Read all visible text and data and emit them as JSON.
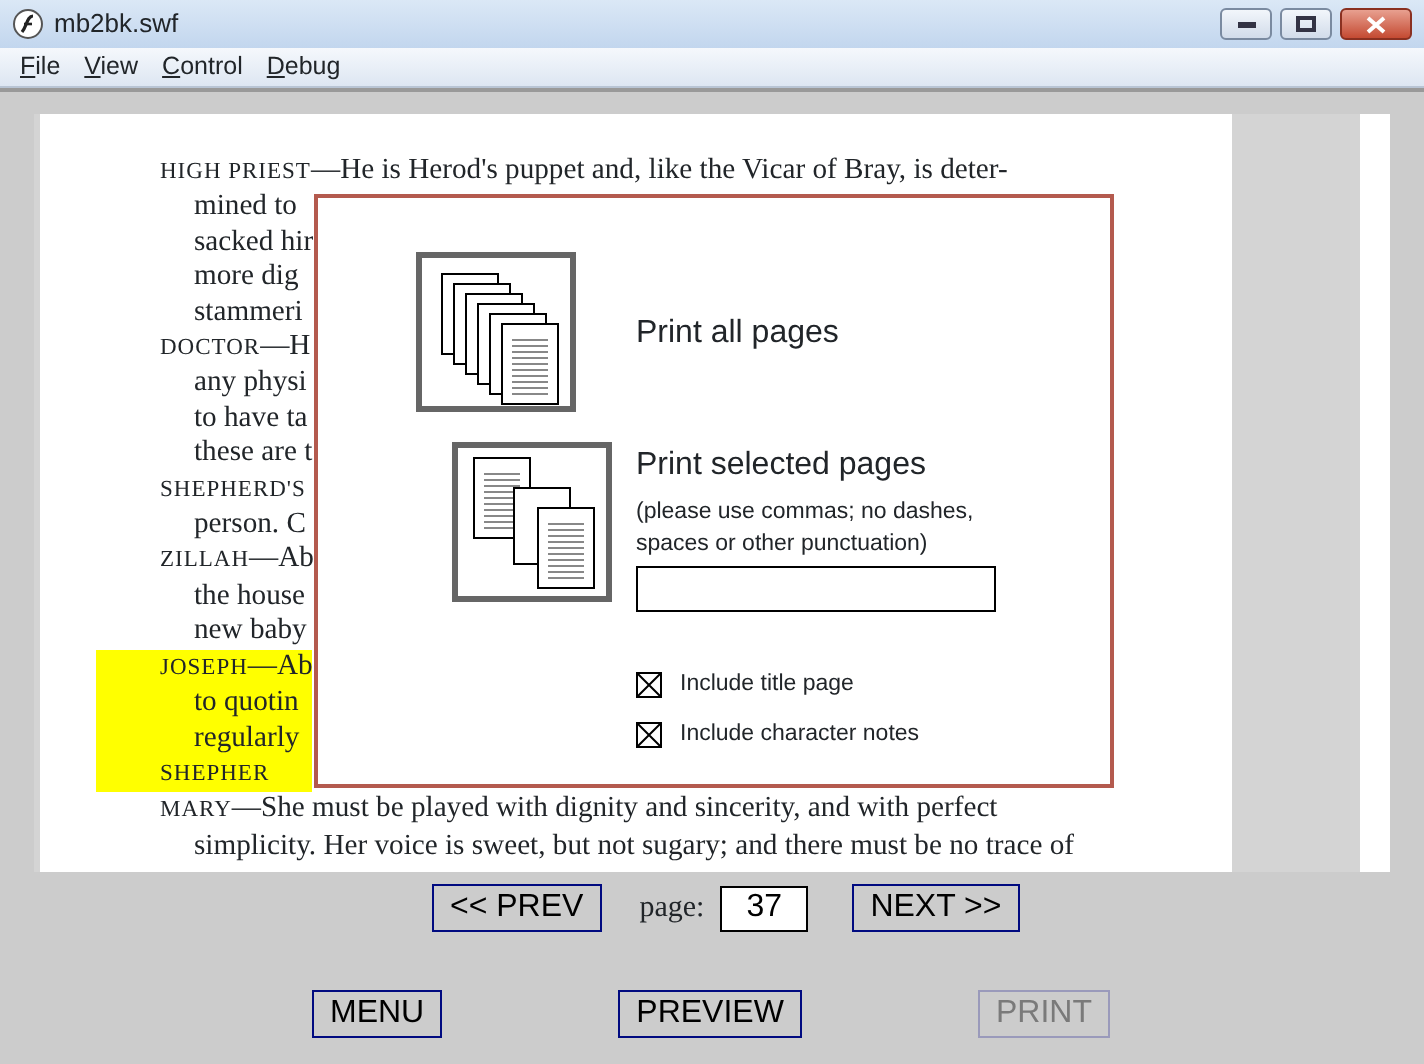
{
  "window": {
    "title": "mb2bk.swf"
  },
  "menu": [
    {
      "label": "File"
    },
    {
      "label": "View"
    },
    {
      "label": "Control"
    },
    {
      "label": "Debug"
    }
  ],
  "document": {
    "lines": [
      {
        "kind": "speech",
        "speaker": "HIGH PRIEST",
        "text": "—He is Herod's puppet and, like the Vicar of Bray, is deter-",
        "highlighted": false
      },
      {
        "kind": "continuation",
        "text": "mined to",
        "highlighted": false
      },
      {
        "kind": "continuation",
        "text": "sacked hir",
        "highlighted": false
      },
      {
        "kind": "continuation",
        "text": "more dig",
        "highlighted": false
      },
      {
        "kind": "continuation",
        "text": "stammeri",
        "highlighted": false
      },
      {
        "kind": "speech",
        "speaker": "DOCTOR",
        "text": "—H",
        "highlighted": false
      },
      {
        "kind": "continuation",
        "text": "any physi",
        "highlighted": false
      },
      {
        "kind": "continuation",
        "text": "to have ta",
        "highlighted": false
      },
      {
        "kind": "continuation",
        "text": "these are t",
        "highlighted": false
      },
      {
        "kind": "speech",
        "speaker": "SHEPHERD'S",
        "highlighted": false
      },
      {
        "kind": "continuation",
        "text": "person. C",
        "highlighted": false
      },
      {
        "kind": "speech",
        "speaker": "ZILLAH",
        "text": "—Ab",
        "highlighted": false
      },
      {
        "kind": "continuation",
        "text": "the house",
        "highlighted": false
      },
      {
        "kind": "continuation",
        "text": "new baby",
        "highlighted": false
      },
      {
        "kind": "speech",
        "speaker": "JOSEPH",
        "text": "—Ab",
        "highlighted": true
      },
      {
        "kind": "continuation",
        "text": "to quotin",
        "highlighted": true
      },
      {
        "kind": "continuation",
        "text": "regularly",
        "highlighted": true
      },
      {
        "kind": "speech",
        "speaker": "SHEPHER",
        "highlighted": true
      },
      {
        "kind": "speech",
        "speaker": "MARY",
        "text": "—She must be played with dignity and sincerity, and with perfect",
        "highlighted": false
      },
      {
        "kind": "continuation",
        "text": "simplicity. Her voice is sweet, but not sugary; and there must be no trace of",
        "highlighted": false
      }
    ]
  },
  "print_dialog": {
    "options": [
      {
        "kind": "all",
        "label": "Print all pages"
      },
      {
        "kind": "selected",
        "label": "Print selected pages",
        "note": "(please use commas; no dashes, spaces or other punctuation)"
      }
    ],
    "checkboxes": [
      {
        "label": "Include title page",
        "checked": true
      },
      {
        "label": "Include character notes",
        "checked": true
      }
    ]
  },
  "navigation": {
    "prev": "<< PREV",
    "page_label": "page:",
    "page_value": "37",
    "next": "NEXT >>"
  },
  "buttons": [
    {
      "label": "MENU",
      "disabled": false
    },
    {
      "label": "PREVIEW",
      "disabled": false
    },
    {
      "label": "PRINT",
      "disabled": true
    }
  ]
}
